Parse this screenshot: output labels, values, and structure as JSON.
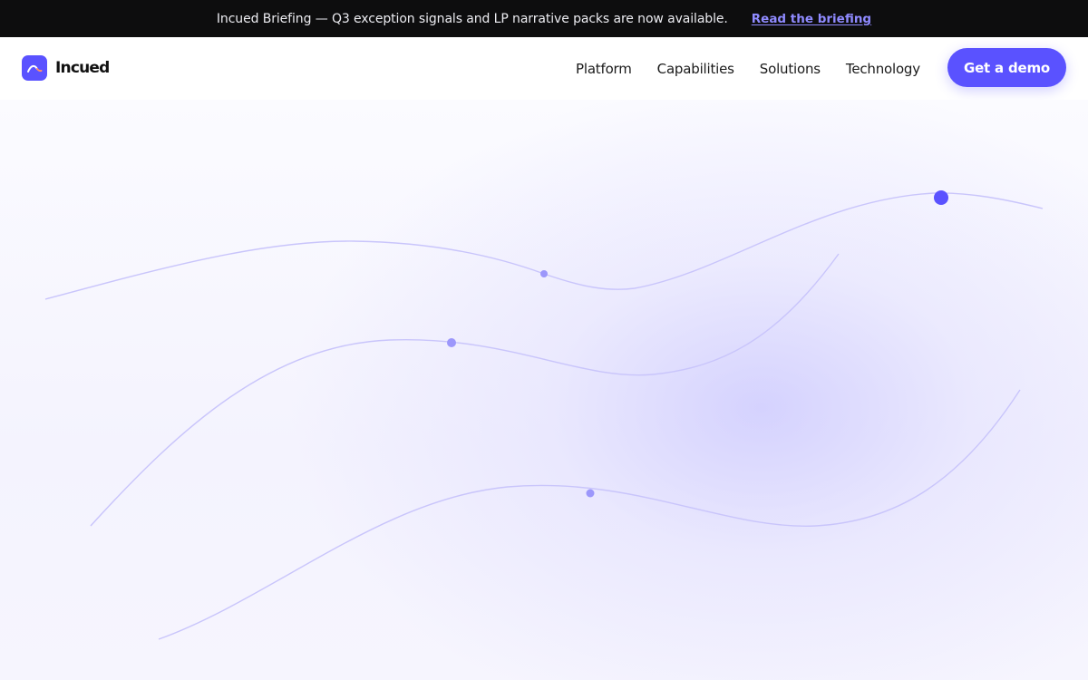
{
  "announcement": {
    "message": "Incued Briefing — Q3 exception signals and LP narrative packs are now available.",
    "link_label": "Read the briefing"
  },
  "brand": {
    "name": "Incued",
    "accent_color": "#5a52ff"
  },
  "nav": {
    "items": [
      {
        "label": "Platform"
      },
      {
        "label": "Capabilities"
      },
      {
        "label": "Solutions"
      },
      {
        "label": "Technology"
      }
    ],
    "cta_label": "Get a demo"
  },
  "colors": {
    "announcement_bg": "#0d0d0e",
    "link": "#8f8aff",
    "curve": "#c9c5fb",
    "node": "#9c97fb"
  }
}
